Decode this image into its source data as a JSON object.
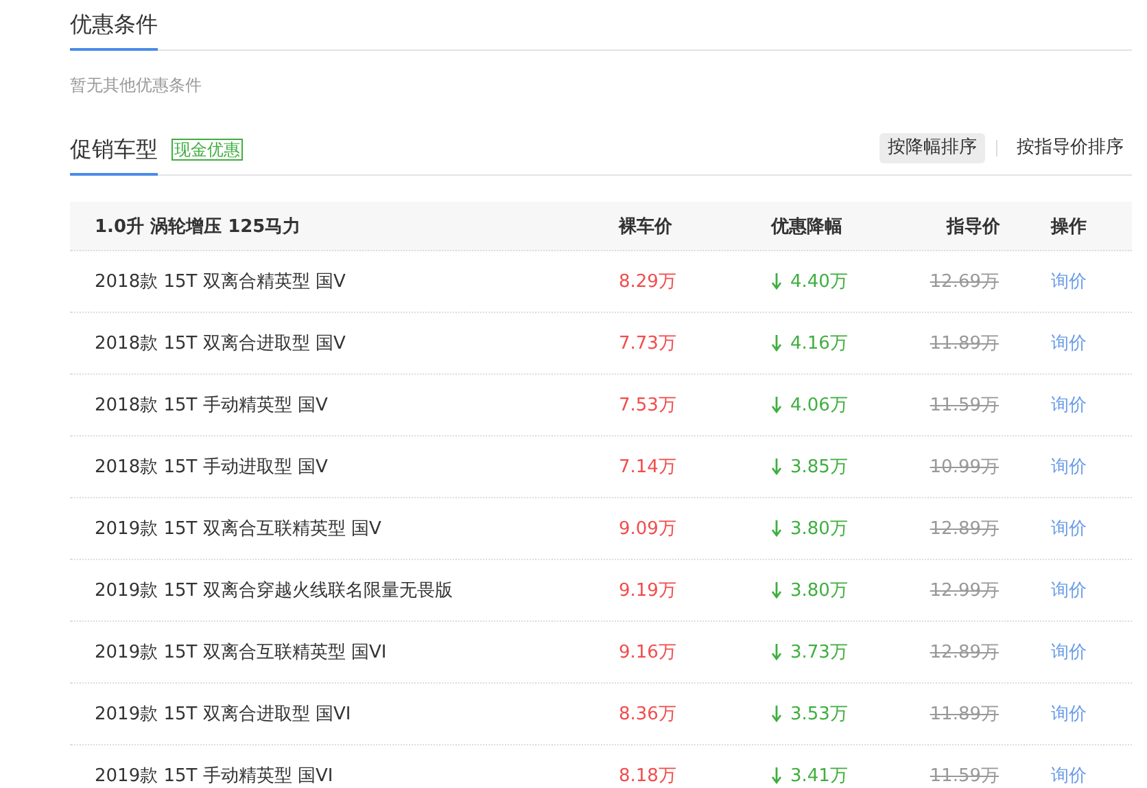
{
  "conditions": {
    "title": "优惠条件",
    "note": "暂无其他优惠条件"
  },
  "promo": {
    "title": "促销车型",
    "badge": "现金优惠",
    "sort_options": [
      {
        "label": "按降幅排序",
        "selected": true
      },
      {
        "label": "按指导价排序",
        "selected": false
      }
    ]
  },
  "table": {
    "columns": [
      "1.0升 涡轮增压 125马力",
      "裸车价",
      "优惠降幅",
      "指导价",
      "操作"
    ],
    "rows": [
      {
        "model": "2018款 15T 双离合精英型 国V",
        "price": "8.29万",
        "discount": "4.40万",
        "guide_price": "12.69万",
        "action": "询价"
      },
      {
        "model": "2018款 15T 双离合进取型 国V",
        "price": "7.73万",
        "discount": "4.16万",
        "guide_price": "11.89万",
        "action": "询价"
      },
      {
        "model": "2018款 15T 手动精英型 国V",
        "price": "7.53万",
        "discount": "4.06万",
        "guide_price": "11.59万",
        "action": "询价"
      },
      {
        "model": "2018款 15T 手动进取型 国V",
        "price": "7.14万",
        "discount": "3.85万",
        "guide_price": "10.99万",
        "action": "询价"
      },
      {
        "model": "2019款 15T 双离合互联精英型 国V",
        "price": "9.09万",
        "discount": "3.80万",
        "guide_price": "12.89万",
        "action": "询价"
      },
      {
        "model": "2019款 15T 双离合穿越火线联名限量无畏版",
        "price": "9.19万",
        "discount": "3.80万",
        "guide_price": "12.99万",
        "action": "询价"
      },
      {
        "model": "2019款 15T 双离合互联精英型 国VI",
        "price": "9.16万",
        "discount": "3.73万",
        "guide_price": "12.89万",
        "action": "询价"
      },
      {
        "model": "2019款 15T 双离合进取型 国VI",
        "price": "8.36万",
        "discount": "3.53万",
        "guide_price": "11.89万",
        "action": "询价"
      },
      {
        "model": "2019款 15T 手动精英型 国VI",
        "price": "8.18万",
        "discount": "3.41万",
        "guide_price": "11.59万",
        "action": "询价"
      }
    ]
  }
}
